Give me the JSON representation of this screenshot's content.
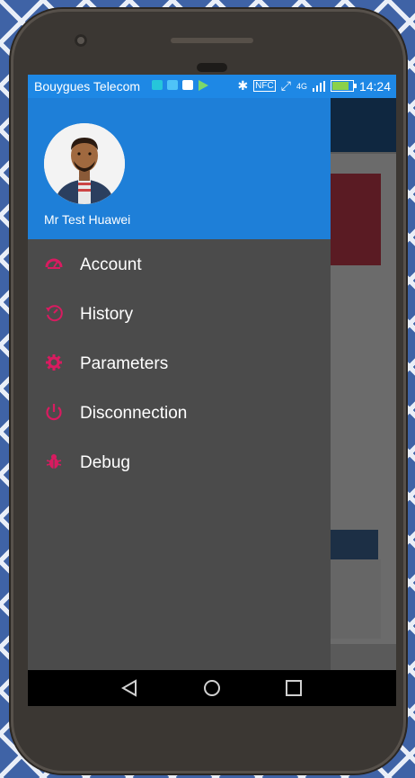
{
  "statusbar": {
    "carrier": "Bouygues Telecom",
    "time": "14:24",
    "network": "4G"
  },
  "drawer": {
    "user_name": "Mr Test Huawei",
    "items": [
      {
        "label": "Account",
        "icon": "gauge-icon"
      },
      {
        "label": "History",
        "icon": "history-icon"
      },
      {
        "label": "Parameters",
        "icon": "gear-icon"
      },
      {
        "label": "Disconnection",
        "icon": "power-icon"
      },
      {
        "label": "Debug",
        "icon": "bug-icon"
      }
    ]
  },
  "colors": {
    "accent": "#d81b60",
    "header": "#1e7fd8",
    "drawer_bg": "#4b4b4b"
  }
}
